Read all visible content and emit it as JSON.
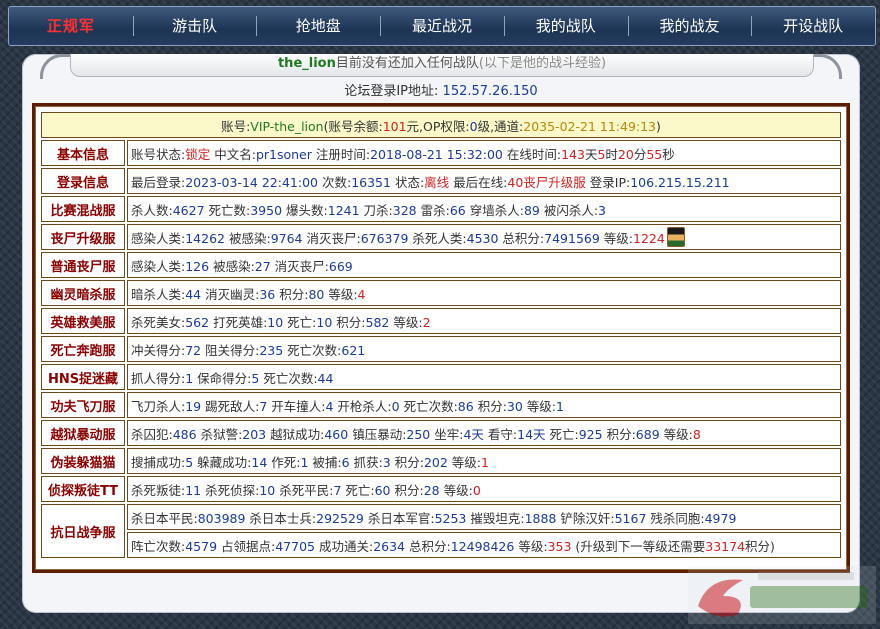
{
  "nav": {
    "brand": "正规军",
    "items": [
      "游击队",
      "抢地盘",
      "最近战况",
      "我的战队",
      "我的战友",
      "开设战队"
    ]
  },
  "banner": {
    "username": "the_lion",
    "text": "目前没有还加入任何战队",
    "note": "(以下是他的战斗经验)"
  },
  "ip_line": {
    "label": "论坛登录IP地址:",
    "value": "152.57.26.150"
  },
  "account": {
    "label": "账号:",
    "id": "VIP-the_lion",
    "balance_label": "(账号余额:",
    "balance": "101",
    "balance_unit": "元,OP权限:",
    "op": "0",
    "op_unit": "级,通道:",
    "channel": "2035-02-21 11:49:13",
    "close": ")"
  },
  "rows": {
    "basic": {
      "label": "基本信息",
      "status_label": "账号状态:",
      "status": "锁定",
      "cn_label": "中文名:",
      "cn": "pr1soner",
      "reg_label": "注册时间:",
      "reg": "2018-08-21 15:32:00",
      "online_label": "在线时间:",
      "d": "143",
      "d_u": "天",
      "h": "5",
      "h_u": "时",
      "m": "20",
      "m_u": "分",
      "s": "55",
      "s_u": "秒"
    },
    "login": {
      "label": "登录信息",
      "last_label": "最后登录:",
      "last": "2023-03-14 22:41:00",
      "times_label": "次数:",
      "times": "16351",
      "state_label": "状态:",
      "state": "离线",
      "last_on_label": "最后在线:",
      "last_on": "40丧尸升级服",
      "ip_label": "登录IP:",
      "ip": "106.215.15.211"
    },
    "mixed": {
      "label": "比赛混战服",
      "kills_label": "杀人数:",
      "kills": "4627",
      "deaths_label": "死亡数:",
      "deaths": "3950",
      "hs_label": "爆头数:",
      "hs": "1241",
      "knife_label": "刀杀:",
      "knife": "328",
      "nade_label": "雷杀:",
      "nade": "66",
      "wall_label": "穿墙杀人:",
      "wall": "89",
      "flashed_label": "被闪杀人:",
      "flashed": "3"
    },
    "zombie_up": {
      "label": "丧尸升级服",
      "inf_label": "感染人类:",
      "inf": "14262",
      "infd_label": "被感染:",
      "infd": "9764",
      "zk_label": "消灭丧尸:",
      "zk": "676379",
      "hk_label": "杀死人类:",
      "hk": "4530",
      "score_label": "总积分:",
      "score": "7491569",
      "lvl_label": "等级:",
      "lvl": "1224"
    },
    "zombie": {
      "label": "普通丧尸服",
      "inf_label": "感染人类:",
      "inf": "126",
      "infd_label": "被感染:",
      "infd": "27",
      "zk_label": "消灭丧尸:",
      "zk": "669"
    },
    "ghost": {
      "label": "幽灵暗杀服",
      "a_label": "暗杀人类:",
      "a": "44",
      "b_label": "消灭幽灵:",
      "b": "36",
      "c_label": "积分:",
      "c": "80",
      "lvl_label": "等级:",
      "lvl": "4"
    },
    "hero": {
      "label": "英雄救美服",
      "a_label": "杀死美女:",
      "a": "562",
      "b_label": "打死英雄:",
      "b": "10",
      "c_label": "死亡:",
      "c": "10",
      "d_label": "积分:",
      "d": "582",
      "lvl_label": "等级:",
      "lvl": "2"
    },
    "deathrun": {
      "label": "死亡奔跑服",
      "a_label": "冲关得分:",
      "a": "72",
      "b_label": "阻关得分:",
      "b": "235",
      "c_label": "死亡次数:",
      "c": "621"
    },
    "hns": {
      "label": "HNS捉迷藏",
      "a_label": "抓人得分:",
      "a": "1",
      "b_label": "保命得分:",
      "b": "5",
      "c_label": "死亡次数:",
      "c": "44"
    },
    "kungfu": {
      "label": "功夫飞刀服",
      "a_label": "飞刀杀人:",
      "a": "19",
      "b_label": "踢死敌人:",
      "b": "7",
      "c_label": "开车撞人:",
      "c": "4",
      "d_label": "开枪杀人:",
      "d": "0",
      "e_label": "死亡次数:",
      "e": "86",
      "f_label": "积分:",
      "f": "30",
      "lvl_label": "等级:",
      "lvl": "1"
    },
    "jail": {
      "label": "越狱暴动服",
      "a_label": "杀囚犯:",
      "a": "486",
      "b_label": "杀狱警:",
      "b": "203",
      "c_label": "越狱成功:",
      "c": "460",
      "d_label": "镇压暴动:",
      "d": "250",
      "e_label": "坐牢:",
      "e": "4天",
      "f_label": "看守:",
      "f": "14天",
      "g_label": "死亡:",
      "g": "925",
      "h_label": "积分:",
      "h": "689",
      "lvl_label": "等级:",
      "lvl": "8"
    },
    "prop": {
      "label": "伪装躲猫猫",
      "a_label": "搜捕成功:",
      "a": "5",
      "b_label": "躲藏成功:",
      "b": "14",
      "c_label": "作死:",
      "c": "1",
      "d_label": "被捕:",
      "d": "6",
      "e_label": "抓获:",
      "e": "3",
      "f_label": "积分:",
      "f": "202",
      "lvl_label": "等级:",
      "lvl": "1"
    },
    "traitor": {
      "label": "侦探叛徒TT",
      "a_label": "杀死叛徒:",
      "a": "11",
      "b_label": "杀死侦探:",
      "b": "10",
      "c_label": "杀死平民:",
      "c": "7",
      "d_label": "死亡:",
      "d": "60",
      "e_label": "积分:",
      "e": "28",
      "lvl_label": "等级:",
      "lvl": "0"
    },
    "war": {
      "label": "抗日战争服",
      "a_label": "杀日本平民:",
      "a": "803989",
      "b_label": "杀日本士兵:",
      "b": "292529",
      "c_label": "杀日本军官:",
      "c": "5253",
      "d_label": "摧毁坦克:",
      "d": "1888",
      "e_label": "铲除汉奸:",
      "e": "5167",
      "f_label": "残杀同胞:",
      "f": "4979",
      "g_label": "阵亡次数:",
      "g": "4579",
      "h_label": "占领据点:",
      "h": "47705",
      "i_label": "成功通关:",
      "i": "2634",
      "j_label": "总积分:",
      "j": "12498426",
      "lvl_label": "等级:",
      "lvl": "353",
      "next_pre": "(升级到下一等级还需要",
      "next": "33174",
      "next_post": "积分)"
    }
  },
  "colors": {
    "label": "#8c0000",
    "value": "#1a3a9c",
    "alert": "#d42020",
    "header_bg": "#fbf9c9"
  },
  "watermark": "logo-watermark"
}
